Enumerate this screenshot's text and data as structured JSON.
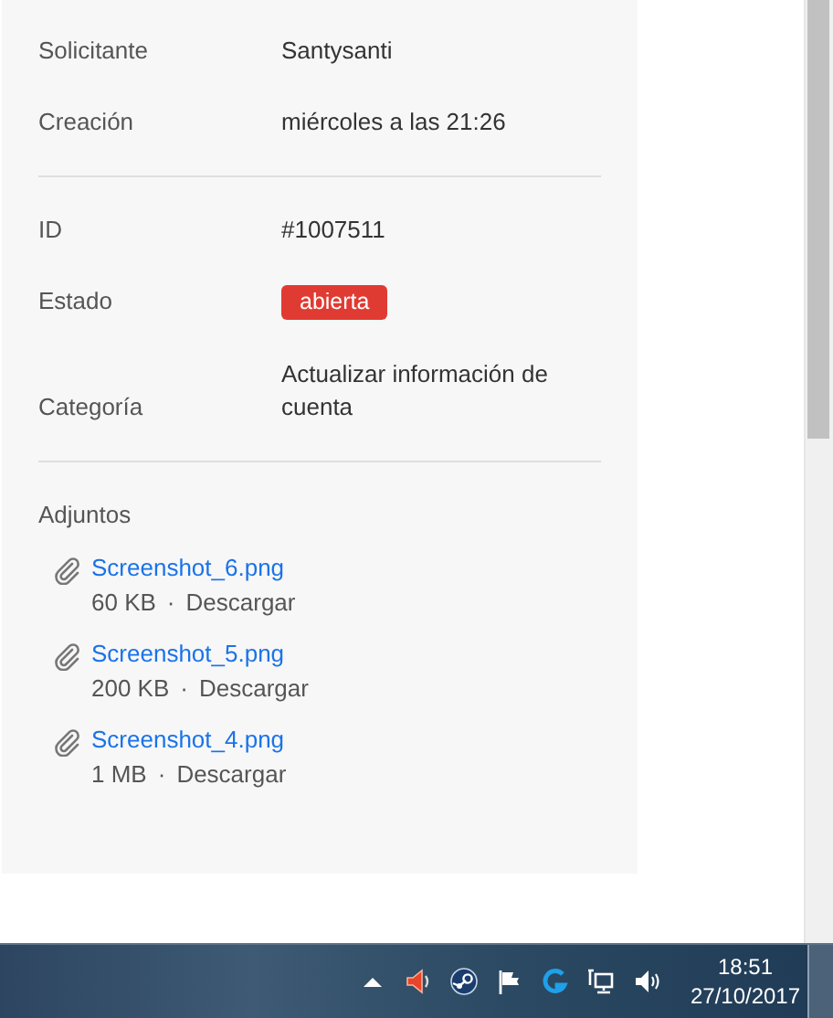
{
  "details": [
    {
      "rows": [
        {
          "label": "Solicitante",
          "kind": "text",
          "value": "Santysanti"
        },
        {
          "label": "Creación",
          "kind": "text",
          "value": "miércoles a las 21:26"
        }
      ]
    },
    {
      "rows": [
        {
          "label": "ID",
          "kind": "text",
          "value": "#1007511"
        },
        {
          "label": "Estado",
          "kind": "badge",
          "value": "abierta",
          "color": "#e03b32"
        },
        {
          "label": "Categoría",
          "kind": "text",
          "value": "Actualizar información de cuenta"
        }
      ]
    }
  ],
  "attachments": {
    "title": "Adjuntos",
    "items": [
      {
        "name": "Screenshot_6.png",
        "size": "60 KB",
        "separator": "·",
        "action": "Descargar"
      },
      {
        "name": "Screenshot_5.png",
        "size": "200 KB",
        "separator": "·",
        "action": "Descargar"
      },
      {
        "name": "Screenshot_4.png",
        "size": "1 MB",
        "separator": "·",
        "action": "Descargar"
      }
    ]
  },
  "taskbar": {
    "time": "18:51",
    "date": "27/10/2017"
  }
}
